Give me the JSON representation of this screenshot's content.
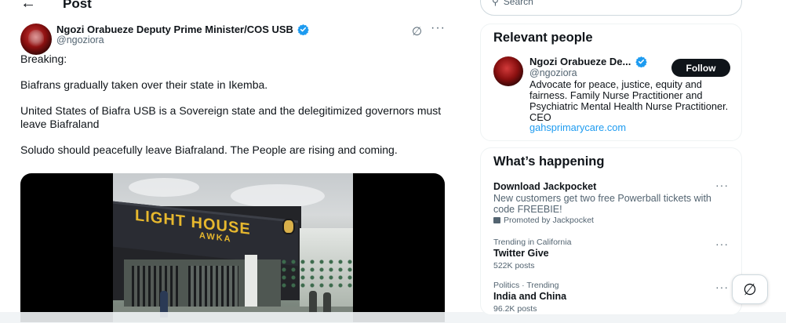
{
  "header": {
    "back_icon": "left-arrow-icon",
    "title": "Post"
  },
  "post": {
    "author_name": "Ngozi Orabueze Deputy Prime Minister/COS USB",
    "author_handle": "@ngoziora",
    "verified": true,
    "paragraphs": [
      "Breaking:",
      "Biafrans gradually taken over their state in Ikemba.",
      "United States of Biafra USB is a Sovereign state and the delegitimized governors must leave Biafraland",
      "Soludo should peacefully leave Biafraland. The People are rising and coming."
    ],
    "media": {
      "sign_main": "LIGHT HOUSE",
      "sign_sub": "AWKA"
    }
  },
  "search": {
    "placeholder": "Search"
  },
  "relevant_people": {
    "title": "Relevant people",
    "name": "Ngozi Orabueze De...",
    "handle": "@ngoziora",
    "follow_label": "Follow",
    "bio": "Advocate for peace, justice, equity and fairness. Family Nurse Practitioner and Psychiatric Mental Health Nurse Practitioner. CEO",
    "link": "gahsprimarycare.com"
  },
  "whats_happening": {
    "title": "What’s happening",
    "items": [
      {
        "title": "Download Jackpocket",
        "desc": "New customers get two free Powerball tickets with code FREEBIE!",
        "promo": "Promoted by Jackpocket"
      },
      {
        "context": "Trending in California",
        "title": "Twitter Give",
        "count": "522K posts"
      },
      {
        "context": "Politics · Trending",
        "title": "India and China",
        "count": "96.2K posts"
      }
    ]
  },
  "colors": {
    "accent": "#1d9bf0",
    "text": "#0f1419",
    "muted": "#536471",
    "sign_yellow": "#e7b82e"
  }
}
